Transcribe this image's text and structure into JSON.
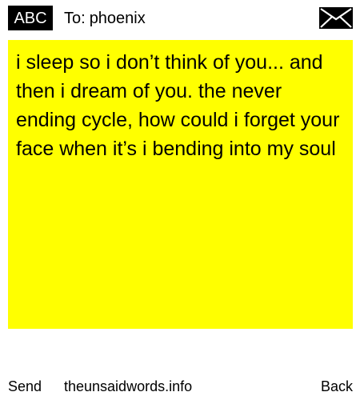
{
  "header": {
    "mode_badge": "ABC",
    "to_label": "To:",
    "recipient": "phoenix",
    "envelope_icon": "envelope-icon"
  },
  "message": {
    "text": "i sleep so i don’t think of you... and then i dream of you. the never ending cycle, how could i forget your face when it’s i bending into my soul",
    "background_color": "#ffff00"
  },
  "footer": {
    "send_label": "Send",
    "site_label": "theunsaidwords.info",
    "back_label": "Back"
  }
}
